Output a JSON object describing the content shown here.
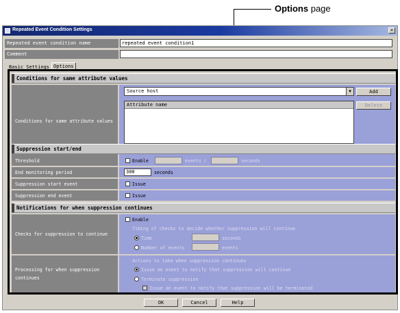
{
  "callout": {
    "bold": "Options",
    "rest": " page"
  },
  "window": {
    "title": "Repeated Event Condition Settings",
    "close": "×"
  },
  "header_fields": [
    {
      "label": "Repeated event condition name",
      "value": "repeated event condition1"
    },
    {
      "label": "Comment",
      "value": ""
    }
  ],
  "tabs": [
    {
      "label": "Basic Settings"
    },
    {
      "label": "Options"
    }
  ],
  "sections": {
    "same_attr": "Conditions for same attribute values",
    "suppression": "Suppression start/end",
    "notifications": "Notifications for when suppression continues"
  },
  "same_attr": {
    "label": "Conditions for same attribute values",
    "selected": "Source host",
    "add": "Add",
    "delete": "Delete",
    "list_header": "Attribute name"
  },
  "threshold": {
    "label": "Threshold",
    "enable": "Enable",
    "events": "events /",
    "seconds": "seconds"
  },
  "end_monitoring": {
    "label": "End monitoring period",
    "value": "300",
    "unit": "seconds"
  },
  "start_event": {
    "label": "Suppression start event",
    "issue": "Issue"
  },
  "end_event": {
    "label": "Suppression end event",
    "issue": "Issue"
  },
  "checks": {
    "label": "Checks for suppression to continue",
    "enable": "Enable",
    "timing": "Timing of checks to decide whether suppression will continue",
    "time": "Time",
    "seconds": "seconds",
    "number": "Number of events",
    "events": "events"
  },
  "processing": {
    "label1": "Processing for when suppression",
    "label2": "continues",
    "actions": "Actions to take when suppression continues",
    "issue_notify": "Issue an event to notify that suppression will continue",
    "terminate": "Terminate suppression",
    "issue_terminated": "Issue an event to notify that suppression will be terminated"
  },
  "footer": {
    "ok": "OK",
    "cancel": "Cancel",
    "help": "Help"
  }
}
